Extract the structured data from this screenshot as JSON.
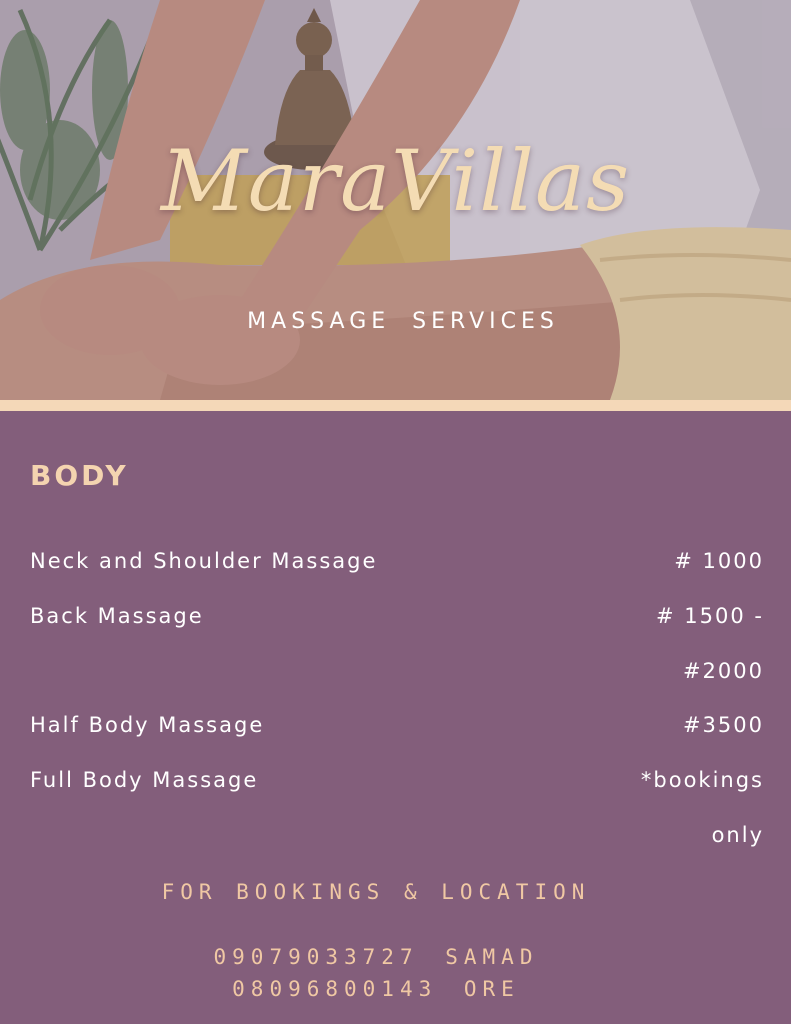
{
  "brand": {
    "name": "MaraVillas",
    "tagline": "MASSAGE SERVICES"
  },
  "menu": {
    "section": "BODY",
    "items": [
      {
        "name": "Neck and Shoulder Massage",
        "price": "# 1000"
      },
      {
        "name": "Back Massage",
        "price": "# 1500 -",
        "price_cont": "#2000"
      },
      {
        "name": "Half Body Massage",
        "price": "#3500"
      },
      {
        "name": "Full Body Massage",
        "price": "*bookings",
        "price_cont": "only"
      }
    ]
  },
  "contact": {
    "heading": "FOR BOOKINGS & LOCATION",
    "phones": [
      {
        "number": "09079033727",
        "name": "SAMAD"
      },
      {
        "number": "08096800143",
        "name": "ORE"
      }
    ]
  },
  "colors": {
    "background": "#835e7b",
    "accent": "#f4d4b0",
    "divider": "#f4d8b8",
    "text": "#ffffff"
  },
  "image": {
    "description_icon": "massage-photo",
    "elements": [
      "palm-plant",
      "buddha-statue",
      "massage-hands",
      "towel"
    ]
  }
}
